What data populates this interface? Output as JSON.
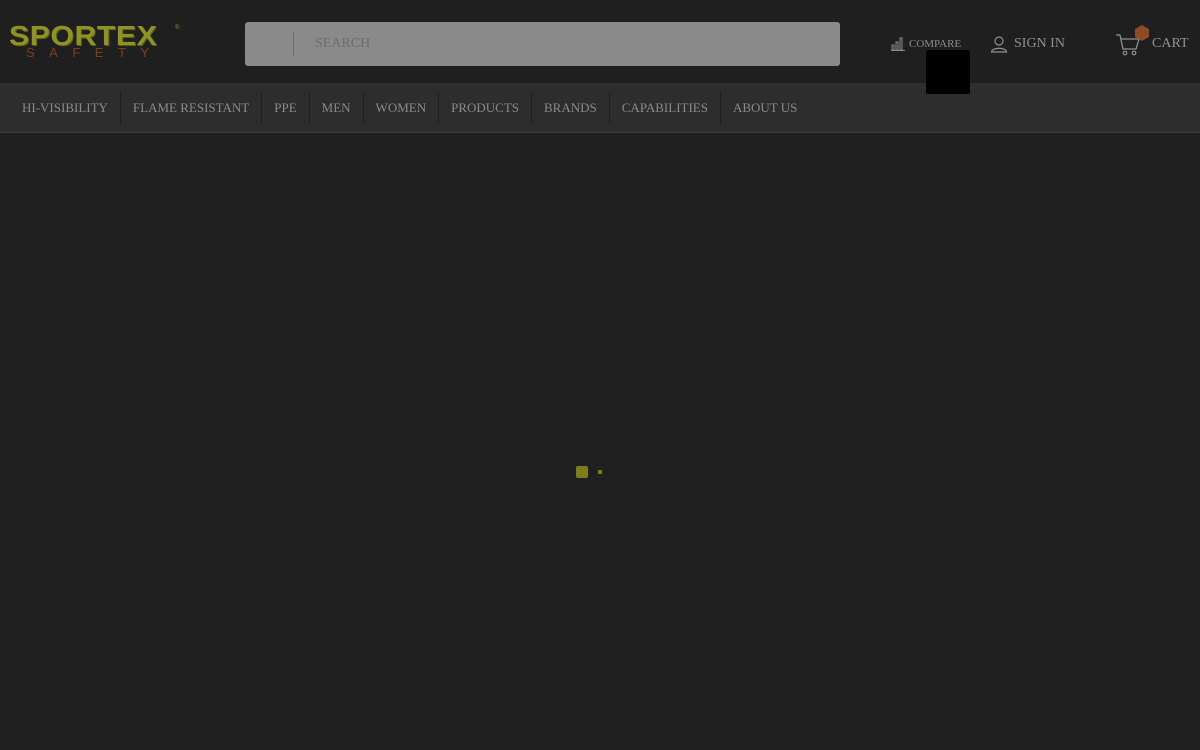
{
  "brand": {
    "name": "SPORTEX",
    "tagline": "SAFETY",
    "tm": "®",
    "primary_color": "#8f9226",
    "secondary_color": "#7e3e1e"
  },
  "search": {
    "placeholder": "SEARCH",
    "value": ""
  },
  "header_actions": {
    "compare_label": "COMPARE",
    "compare_icon": "bar-chart-icon",
    "signin_label": "SIGN IN",
    "signin_icon": "user-icon",
    "cart_label": "CART",
    "cart_icon": "shopping-cart-icon",
    "cart_badge_color": "#a0522d"
  },
  "nav": {
    "items": [
      {
        "label": "HI-VISIBILITY"
      },
      {
        "label": "FLAME RESISTANT"
      },
      {
        "label": "PPE"
      },
      {
        "label": "MEN"
      },
      {
        "label": "WOMEN"
      },
      {
        "label": "PRODUCTS"
      },
      {
        "label": "BRANDS"
      },
      {
        "label": "CAPABILITIES"
      },
      {
        "label": "ABOUT US"
      }
    ]
  },
  "loader": {
    "color": "#7c7d20"
  }
}
